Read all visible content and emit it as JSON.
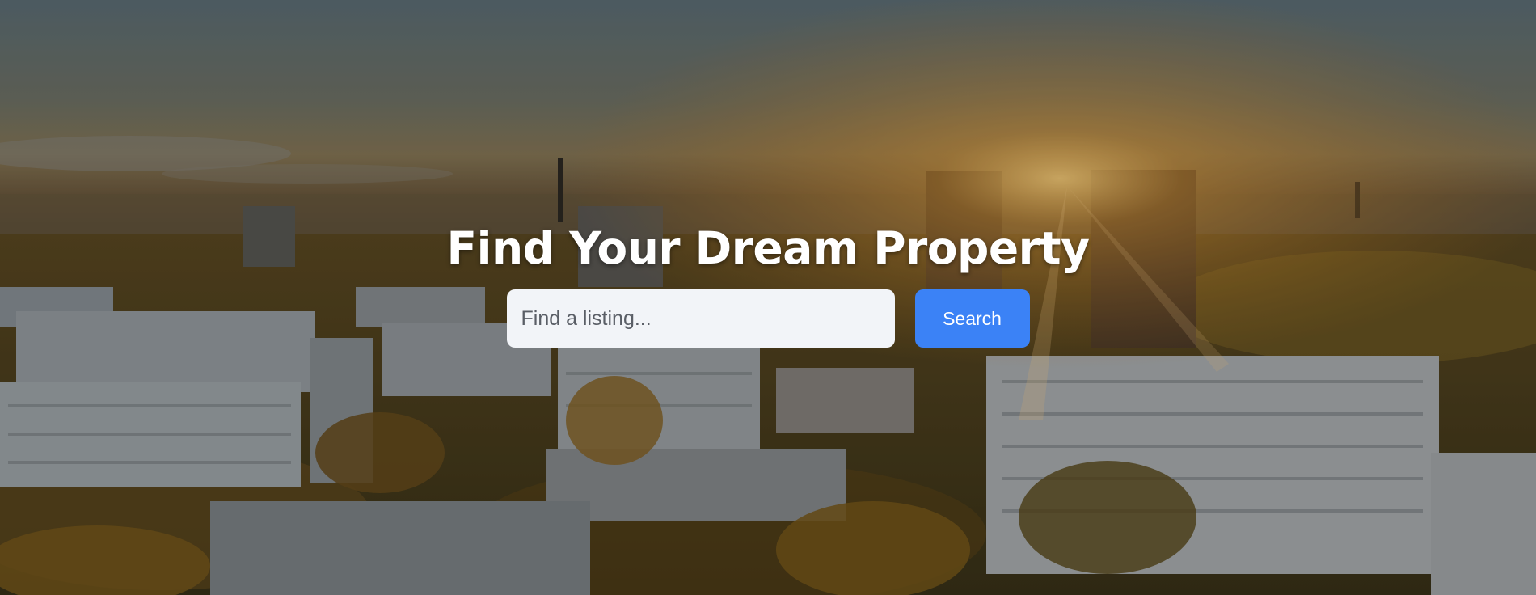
{
  "hero": {
    "title": "Find Your Dream Property",
    "background_image": "city-sunrise-apartment-blocks"
  },
  "search": {
    "placeholder": "Find a listing...",
    "value": "",
    "button_label": "Search"
  },
  "colors": {
    "button": "#3b82f6",
    "input_background": "#f2f4f8",
    "title_text": "#ffffff"
  }
}
